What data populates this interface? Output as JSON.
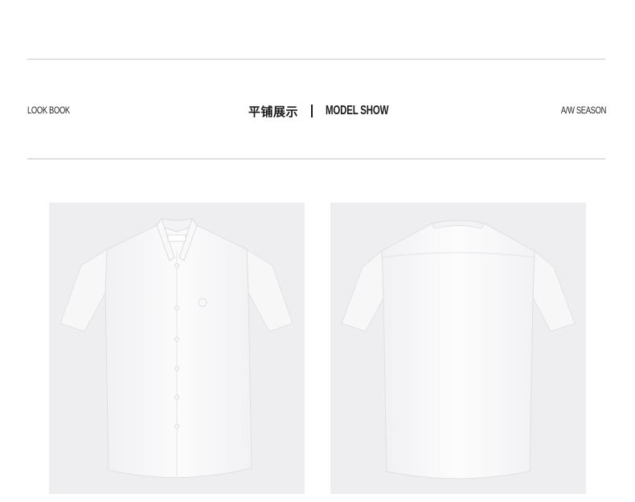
{
  "header": {
    "left_label": "LOOK BOOK",
    "title_cn": "平铺展示",
    "title_en": "MODEL SHOW",
    "right_label": "A/W SEASON"
  },
  "images": [
    {
      "name": "shirt-front-image",
      "view": "front"
    },
    {
      "name": "shirt-back-image",
      "view": "back"
    }
  ],
  "colors": {
    "background": "#ffffff",
    "rule": "#c9c9c9",
    "photo_bg": "#eeeef0",
    "shirt": "#fafafa",
    "text": "#1a1a1a"
  }
}
